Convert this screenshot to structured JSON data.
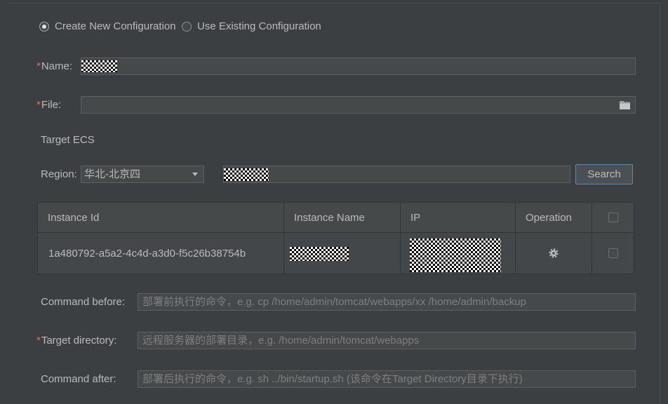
{
  "colors": {
    "background": "#3c3f41",
    "field": "#45494a",
    "text": "#bbbbbb",
    "placeholder": "#7f7f7f",
    "required": "#f06767"
  },
  "icons": {
    "file_browse": "folder-icon",
    "region_dropdown": "chevron-down-icon",
    "operation": "gear-icon"
  },
  "config_mode": {
    "create_new": {
      "label": "Create New Configuration",
      "selected": true
    },
    "use_existing": {
      "label": "Use Existing Configuration",
      "selected": false
    }
  },
  "form": {
    "required_marker": "*",
    "name": {
      "label": "Name:"
    },
    "file": {
      "label": "File:"
    }
  },
  "target_ecs": {
    "title": "Target ECS",
    "region": {
      "label": "Region:",
      "value": "华北-北京四"
    },
    "search_button_label": "Search",
    "table": {
      "columns": [
        "Instance Id",
        "Instance Name",
        "IP",
        "Operation"
      ],
      "select_all_checked": false,
      "rows": [
        {
          "instance_id": "1a480792-a5a2-4c4d-a3d0-f5c26b38754b",
          "checked": false
        }
      ]
    }
  },
  "commands": {
    "before": {
      "label": "Command before:",
      "placeholder": "部署前执行的命令，e.g. cp /home/admin/tomcat/webapps/xx /home/admin/backup"
    },
    "target_directory": {
      "label": "Target directory:",
      "placeholder": "远程服务器的部署目录，e.g. /home/admin/tomcat/webapps"
    },
    "after": {
      "label": "Command after:",
      "placeholder": "部署后执行的命令，e.g. sh ../bin/startup.sh (该命令在Target Directory目录下执行)"
    }
  }
}
